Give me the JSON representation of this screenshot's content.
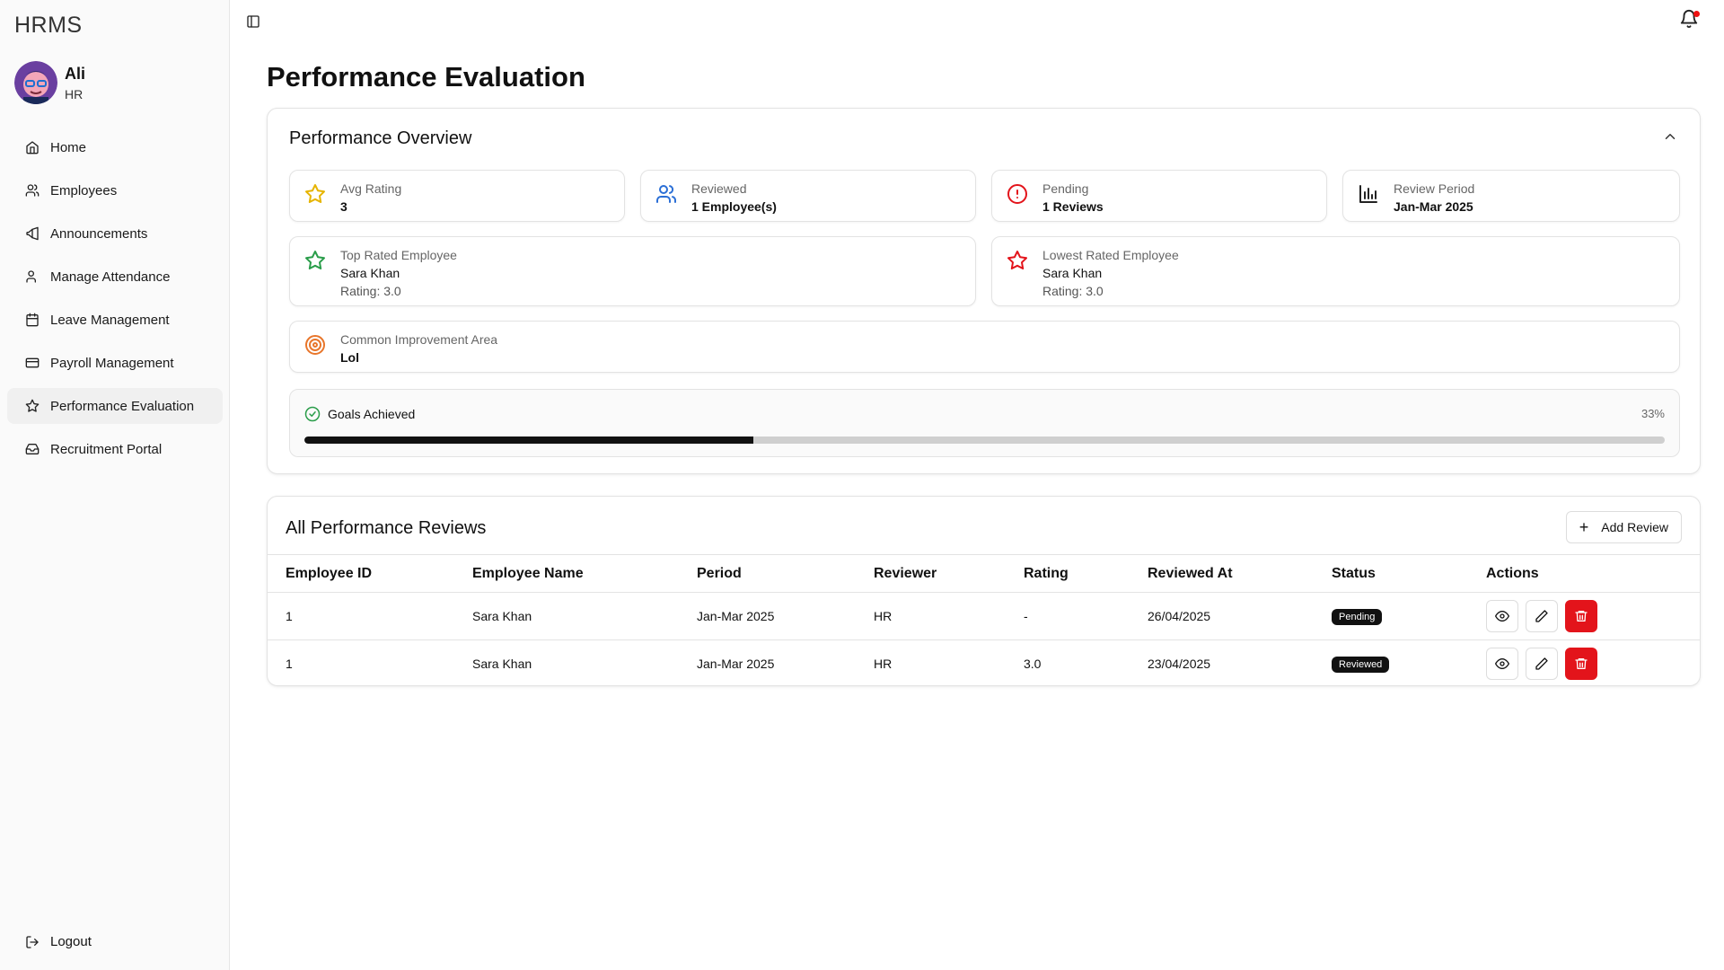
{
  "app": {
    "brand": "HRMS"
  },
  "user": {
    "name": "Ali",
    "role": "HR"
  },
  "sidebar": {
    "items": [
      {
        "label": "Home",
        "icon": "home-icon"
      },
      {
        "label": "Employees",
        "icon": "users-icon"
      },
      {
        "label": "Announcements",
        "icon": "megaphone-icon"
      },
      {
        "label": "Manage Attendance",
        "icon": "user-icon"
      },
      {
        "label": "Leave Management",
        "icon": "calendar-icon"
      },
      {
        "label": "Payroll Management",
        "icon": "credit-card-icon"
      },
      {
        "label": "Performance Evaluation",
        "icon": "star-icon",
        "active": true
      },
      {
        "label": "Recruitment Portal",
        "icon": "inbox-icon"
      }
    ],
    "logout": "Logout"
  },
  "page": {
    "title": "Performance Evaluation"
  },
  "overview": {
    "title": "Performance Overview",
    "avg_rating": {
      "label": "Avg Rating",
      "value": "3"
    },
    "reviewed": {
      "label": "Reviewed",
      "value": "1 Employee(s)"
    },
    "pending": {
      "label": "Pending",
      "value": "1 Reviews"
    },
    "review_period": {
      "label": "Review Period",
      "value": "Jan-Mar 2025"
    },
    "top_rated": {
      "label": "Top Rated Employee",
      "name": "Sara Khan",
      "rating": "Rating: 3.0"
    },
    "lowest_rated": {
      "label": "Lowest Rated Employee",
      "name": "Sara Khan",
      "rating": "Rating: 3.0"
    },
    "improvement": {
      "label": "Common Improvement Area",
      "value": "Lol"
    },
    "goals": {
      "label": "Goals Achieved",
      "percent_text": "33%",
      "fraction": 0.33
    }
  },
  "reviews": {
    "title": "All Performance Reviews",
    "add_label": "Add Review",
    "columns": [
      "Employee ID",
      "Employee Name",
      "Period",
      "Reviewer",
      "Rating",
      "Reviewed At",
      "Status",
      "Actions"
    ],
    "rows": [
      {
        "id": "1",
        "name": "Sara Khan",
        "period": "Jan-Mar 2025",
        "reviewer": "HR",
        "rating": "-",
        "reviewed_at": "26/04/2025",
        "status": "Pending"
      },
      {
        "id": "1",
        "name": "Sara Khan",
        "period": "Jan-Mar 2025",
        "reviewer": "HR",
        "rating": "3.0",
        "reviewed_at": "23/04/2025",
        "status": "Reviewed"
      }
    ]
  },
  "colors": {
    "star_yellow": "#e6b400",
    "blue": "#2b6fd6",
    "red": "#e3141b",
    "green": "#2a9d4a",
    "orange": "#e8762b",
    "danger_button": "#e3141b"
  }
}
